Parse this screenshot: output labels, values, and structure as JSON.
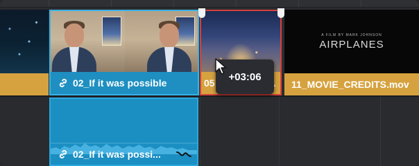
{
  "timeline": {
    "clips": {
      "left_partial": {
        "name": ""
      },
      "interview": {
        "name": "02_If it was possible",
        "thumbnail": "man-talking-office"
      },
      "selected": {
        "name": "05",
        "trailing": "..",
        "thumbnail": "city-night-aerial"
      },
      "credits": {
        "name": "11_MOVIE_CREDITS.mov",
        "thumbnail": "airplanes-title-card",
        "card_small": "A FILM BY MARK JOHNSON",
        "card_title": "AIRPLANES"
      }
    },
    "audio_clip": {
      "name": "02_If it was possi..."
    },
    "trim_tooltip": "+03:06",
    "colors": {
      "selected_outline": "#d9403b",
      "video_clip_blue": "#1e8fc0",
      "clip_orange": "#d6a23f",
      "audio_clip": "#1b8ec2"
    },
    "icons": [
      "link-icon",
      "keyframe-curve-icon",
      "arrow-cursor-icon",
      "trim-handle"
    ]
  }
}
